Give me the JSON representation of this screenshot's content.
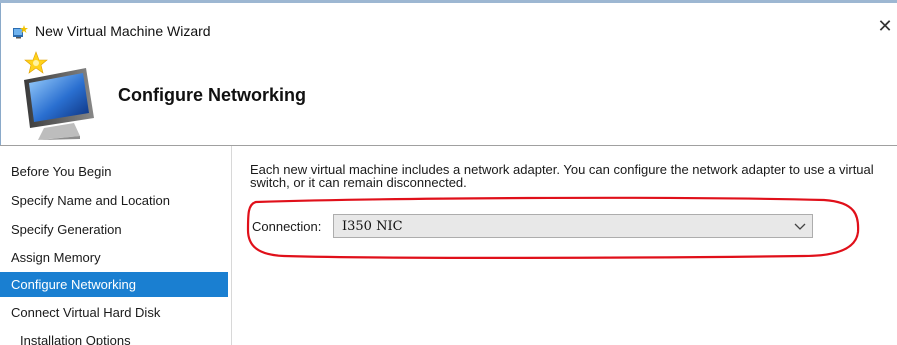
{
  "window": {
    "title": "New Virtual Machine Wizard",
    "close_glyph": "✕",
    "app_icon": "hyper-v-wizard-icon"
  },
  "header": {
    "title": "Configure Networking",
    "icon": "monitor-with-star-icon"
  },
  "sidebar": {
    "items": [
      {
        "label": "Before You Begin",
        "active": false
      },
      {
        "label": "Specify Name and Location",
        "active": false
      },
      {
        "label": "Specify Generation",
        "active": false
      },
      {
        "label": "Assign Memory",
        "active": false
      },
      {
        "label": "Configure Networking",
        "active": true
      },
      {
        "label": "Connect Virtual Hard Disk",
        "active": false
      },
      {
        "label": "Installation Options",
        "active": false
      }
    ]
  },
  "main": {
    "description": "Each new virtual machine includes a network adapter. You can configure the network adapter to use a virtual switch, or it can remain disconnected.",
    "connection": {
      "label": "Connection:",
      "value": "I350 NIC"
    }
  },
  "colors": {
    "active_item_bg": "#1a7fd1",
    "annotation": "#e0101a"
  }
}
